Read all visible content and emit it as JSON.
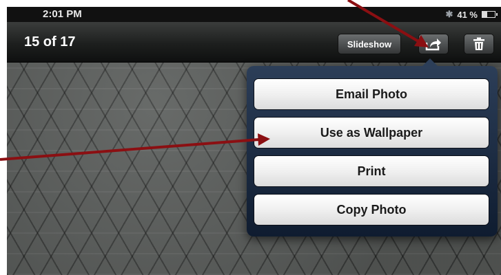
{
  "status_bar": {
    "time": "2:01 PM",
    "battery_percent": "41 %",
    "battery_level": 0.41
  },
  "toolbar": {
    "counter": "15 of 17",
    "slideshow_label": "Slideshow"
  },
  "share_menu": {
    "items": [
      "Email Photo",
      "Use as Wallpaper",
      "Print",
      "Copy Photo"
    ]
  },
  "icons": [
    "bluetooth-icon",
    "battery-icon",
    "share-icon",
    "trash-icon"
  ],
  "colors": {
    "annotation_arrow": "#8b0f12",
    "popover": "#1c2b44",
    "toolbar": "#1d1f1e"
  }
}
